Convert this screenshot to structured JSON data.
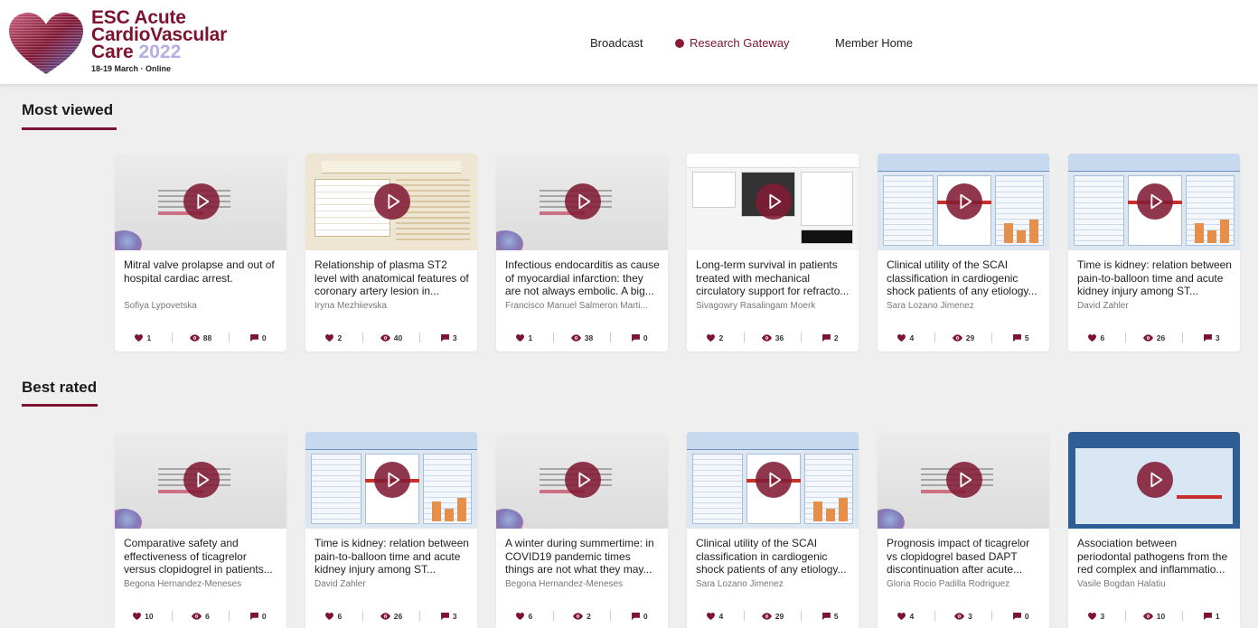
{
  "logo": {
    "line1": "ESC Acute",
    "line2": "CardioVascular",
    "line3_prefix": "Care",
    "line3_year": "2022",
    "subtitle": "18-19 March · Online"
  },
  "nav": {
    "broadcast": "Broadcast",
    "research_gateway": "Research Gateway",
    "member_home": "Member Home"
  },
  "sections": {
    "most_viewed": "Most viewed",
    "best_rated": "Best rated"
  },
  "colors": {
    "accent": "#7d1330",
    "play": "#821b34"
  },
  "most_viewed": [
    {
      "title": "Mitral valve prolapse and out of hospital cardiac arrest.",
      "author": "Sofiya Lypovetska",
      "likes": "1",
      "views": "88",
      "comments": "0",
      "thumb": "gray"
    },
    {
      "title": "Relationship of plasma ST2 level with anatomical features of coronary artery lesion in...",
      "author": "Iryna Mezhiievska",
      "likes": "2",
      "views": "40",
      "comments": "3",
      "thumb": "tan"
    },
    {
      "title": "Infectious endocarditis as cause of myocardial infarction: they are not always embolic. A big...",
      "author": "Francisco Manuel Salmeron Marti...",
      "likes": "1",
      "views": "38",
      "comments": "0",
      "thumb": "gray"
    },
    {
      "title": "Long-term survival in patients treated with mechanical circulatory support for refracto...",
      "author": "Sivagowry Rasalingam Moerk",
      "likes": "2",
      "views": "36",
      "comments": "2",
      "thumb": "poster"
    },
    {
      "title": "Clinical utility of the SCAI classification in cardiogenic shock patients of any etiology...",
      "author": "Sara Lozano Jimenez",
      "likes": "4",
      "views": "29",
      "comments": "5",
      "thumb": "blue"
    },
    {
      "title": "Time is kidney: relation between pain-to-balloon time and acute kidney injury among ST...",
      "author": "David Zahler",
      "likes": "6",
      "views": "26",
      "comments": "3",
      "thumb": "blue"
    }
  ],
  "best_rated": [
    {
      "title": "Comparative safety and effectiveness of ticagrelor versus clopidogrel in patients...",
      "author": "Begona Hernandez-Meneses",
      "likes": "10",
      "views": "6",
      "comments": "0",
      "thumb": "gray"
    },
    {
      "title": "Time is kidney: relation between pain-to-balloon time and acute kidney injury among ST...",
      "author": "David Zahler",
      "likes": "6",
      "views": "26",
      "comments": "3",
      "thumb": "blue"
    },
    {
      "title": "A winter during summertime: in COVID19 pandemic times things are not what they may...",
      "author": "Begona Hernandez-Meneses",
      "likes": "6",
      "views": "2",
      "comments": "0",
      "thumb": "gray"
    },
    {
      "title": "Clinical utility of the SCAI classification in cardiogenic shock patients of any etiology...",
      "author": "Sara Lozano Jimenez",
      "likes": "4",
      "views": "29",
      "comments": "5",
      "thumb": "blue"
    },
    {
      "title": "Prognosis impact of ticagrelor vs clopidogrel based DAPT discontinuation after acute...",
      "author": "Gloria Rocio Padilla Rodriguez",
      "likes": "4",
      "views": "3",
      "comments": "0",
      "thumb": "gray"
    },
    {
      "title": "Association between periodontal pathogens from the red complex and inflammatio...",
      "author": "Vasile Bogdan Halatiu",
      "likes": "3",
      "views": "10",
      "comments": "1",
      "thumb": "navy"
    }
  ]
}
